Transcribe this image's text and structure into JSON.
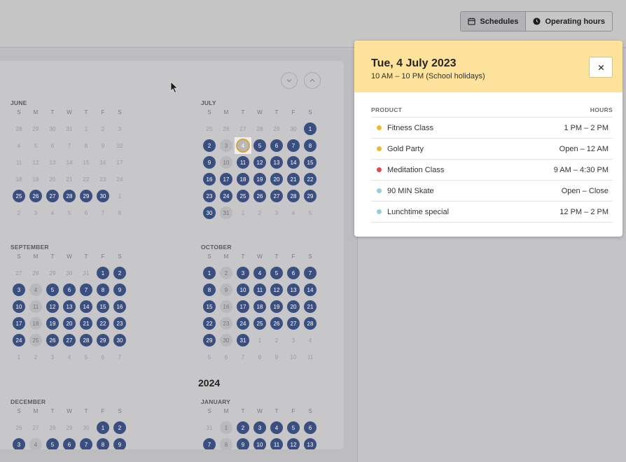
{
  "toggle": {
    "schedules": "Schedules",
    "operating_hours": "Operating hours",
    "schedules_icon": "calendar-icon",
    "operating_icon": "clock-icon"
  },
  "calendar": {
    "weekdays": [
      "S",
      "M",
      "T",
      "W",
      "T",
      "F",
      "S"
    ],
    "year_label": "2024",
    "months": [
      {
        "name": "JUNE",
        "cells": [
          "o:28",
          "o:29",
          "o:30",
          "o:31",
          "o:1",
          "o:2",
          "o:3",
          "o:4",
          "o:5",
          "o:6",
          "o:7",
          "o:8",
          "o:9",
          "o:10",
          "o:11",
          "o:12",
          "o:13",
          "o:14",
          "o:15",
          "o:16",
          "o:17",
          "o:18",
          "o:19",
          "o:20",
          "o:21",
          "o:22",
          "o:23",
          "o:24",
          "a:25",
          "a:26",
          "a:27",
          "a:28",
          "a:29",
          "a:30",
          "o:1",
          "o:2",
          "o:3",
          "o:4",
          "o:5",
          "o:6",
          "o:7",
          "o:8"
        ]
      },
      {
        "name": "JULY",
        "cells": [
          "o:25",
          "o:26",
          "o:27",
          "o:28",
          "o:29",
          "o:30",
          "a:1",
          "a:2",
          "c:3",
          "s:4",
          "a:5",
          "a:6",
          "a:7",
          "a:8",
          "a:9",
          "c:10",
          "a:11",
          "a:12",
          "a:13",
          "a:14",
          "a:15",
          "a:16",
          "a:17",
          "a:18",
          "a:19",
          "a:20",
          "a:21",
          "a:22",
          "a:23",
          "a:24",
          "a:25",
          "a:26",
          "a:27",
          "a:28",
          "a:29",
          "a:30",
          "c:31",
          "o:1",
          "o:2",
          "o:3",
          "o:4",
          "o:5"
        ]
      },
      {
        "name": "SEPTEMBER",
        "cells": [
          "o:27",
          "o:28",
          "o:29",
          "o:30",
          "o:31",
          "a:1",
          "a:2",
          "a:3",
          "c:4",
          "a:5",
          "a:6",
          "a:7",
          "a:8",
          "a:9",
          "a:10",
          "c:11",
          "a:12",
          "a:13",
          "a:14",
          "a:15",
          "a:16",
          "a:17",
          "c:18",
          "a:19",
          "a:20",
          "a:21",
          "a:22",
          "a:23",
          "a:24",
          "c:25",
          "a:26",
          "a:27",
          "a:28",
          "a:29",
          "a:30",
          "o:1",
          "o:2",
          "o:3",
          "o:4",
          "o:5",
          "o:6",
          "o:7"
        ]
      },
      {
        "name": "OCTOBER",
        "cells": [
          "a:1",
          "c:2",
          "a:3",
          "a:4",
          "a:5",
          "a:6",
          "a:7",
          "a:8",
          "c:9",
          "a:10",
          "a:11",
          "a:12",
          "a:13",
          "a:14",
          "a:15",
          "c:16",
          "a:17",
          "a:18",
          "a:19",
          "a:20",
          "a:21",
          "a:22",
          "c:23",
          "a:24",
          "a:25",
          "a:26",
          "a:27",
          "a:28",
          "a:29",
          "c:30",
          "a:31",
          "o:1",
          "o:2",
          "o:3",
          "o:4",
          "o:5",
          "o:6",
          "o:7",
          "o:8",
          "o:9",
          "o:10",
          "o:11"
        ]
      },
      {
        "name": "DECEMBER",
        "cells": [
          "o:26",
          "o:27",
          "o:28",
          "o:29",
          "o:30",
          "a:1",
          "a:2",
          "a:3",
          "c:4",
          "a:5",
          "a:6",
          "a:7",
          "a:8",
          "a:9"
        ]
      },
      {
        "name": "JANUARY",
        "cells": [
          "o:31",
          "c:1",
          "a:2",
          "a:3",
          "a:4",
          "a:5",
          "a:6",
          "a:7",
          "c:8",
          "a:9",
          "a:10",
          "a:11",
          "a:12",
          "a:13"
        ]
      }
    ]
  },
  "panel": {
    "title": "Tue, 4 July 2023",
    "subtitle": "10 AM – 10 PM (School holidays)",
    "close_icon": "close-icon",
    "col_product": "PRODUCT",
    "col_hours": "HOURS",
    "rows": [
      {
        "product": "Fitness Class",
        "hours": "1 PM – 2 PM",
        "color": "#f1b82d"
      },
      {
        "product": "Gold Party",
        "hours": "Open – 12 AM",
        "color": "#f1b82d"
      },
      {
        "product": "Meditation Class",
        "hours": "9 AM – 4:30 PM",
        "color": "#e0484b"
      },
      {
        "product": "90 MIN Skate",
        "hours": "Open – Close",
        "color": "#8fcfe0"
      },
      {
        "product": "Lunchtime special",
        "hours": "12 PM – 2 PM",
        "color": "#8fcfe0"
      }
    ]
  }
}
